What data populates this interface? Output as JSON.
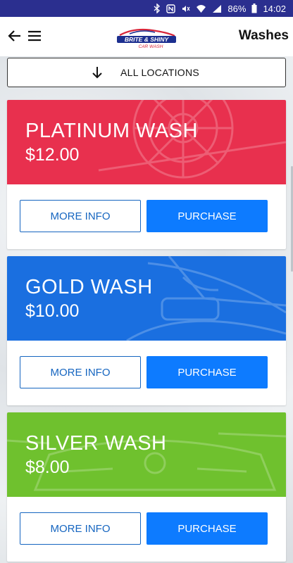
{
  "status": {
    "battery": "86%",
    "time": "14:02"
  },
  "appbar": {
    "title": "Washes",
    "logo_text_top": "BRITE & SHINY",
    "logo_text_bottom": "CAR WASH"
  },
  "location_button": {
    "label": "ALL LOCATIONS"
  },
  "washes": [
    {
      "name": "PLATINUM WASH",
      "price": "$12.00",
      "color": "#e8304e"
    },
    {
      "name": "GOLD WASH",
      "price": "$10.00",
      "color": "#1a6fe0"
    },
    {
      "name": "SILVER WASH",
      "price": "$8.00",
      "color": "#6fc12e"
    }
  ],
  "buttons": {
    "more_info": "MORE INFO",
    "purchase": "PURCHASE"
  },
  "colors": {
    "status_bar": "#2b2f8f",
    "primary": "#0d7bff",
    "outline": "#1565c0"
  }
}
